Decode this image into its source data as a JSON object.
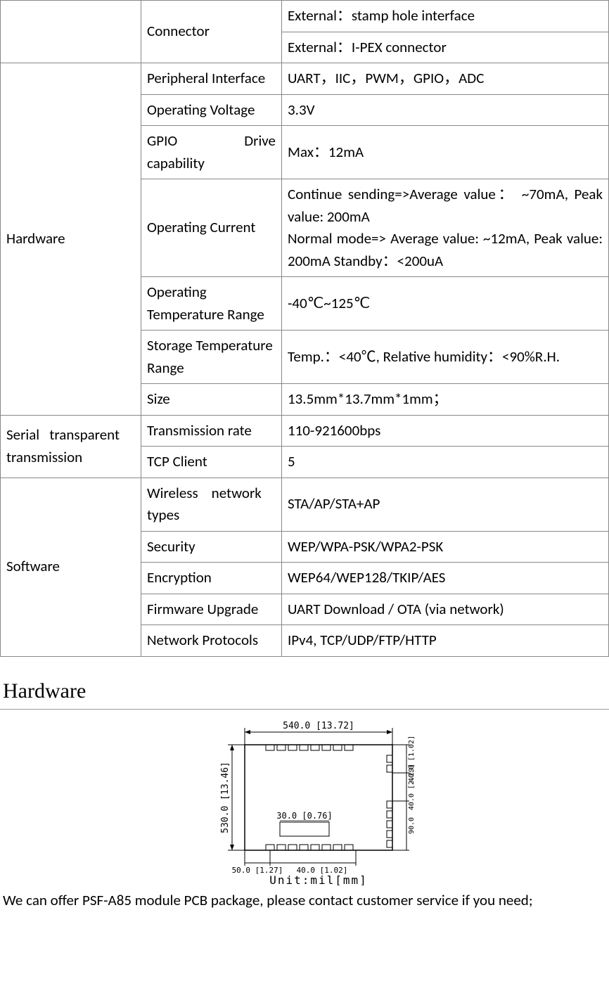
{
  "table": {
    "connector": {
      "label": "Connector",
      "val1": "External：stamp hole interface",
      "val2": "External：I-PEX connector"
    },
    "hardware": {
      "label": "Hardware",
      "rows": [
        {
          "k": "Peripheral Interface",
          "v": "UART，IIC，PWM，GPIO，ADC"
        },
        {
          "k": "Operating Voltage",
          "v": "3.3V"
        },
        {
          "k": "GPIO Drive capability",
          "v": "Max：12mA"
        },
        {
          "k": "Operating Current",
          "v": "Continue sending=>Average value： ~70mA, Peak value: 200mA\nNormal mode=> Average value: ~12mA, Peak value: 200mA Standby：<200uA"
        },
        {
          "k": "Operating Temperature Range",
          "v": "-40℃~125℃"
        },
        {
          "k": "Storage Temperature Range",
          "v": "Temp.：<40℃, Relative humidity：<90%R.H."
        },
        {
          "k": "Size",
          "v": "13.5mm*13.7mm*1mm；"
        }
      ]
    },
    "serial": {
      "label": "Serial transparent transmission",
      "rows": [
        {
          "k": "Transmission rate",
          "v": "110-921600bps"
        },
        {
          "k": "TCP Client",
          "v": "5"
        }
      ]
    },
    "software": {
      "label": "Software",
      "rows": [
        {
          "k": "Wireless network types",
          "v": "STA/AP/STA+AP"
        },
        {
          "k": "Security",
          "v": "WEP/WPA-PSK/WPA2-PSK"
        },
        {
          "k": "Encryption",
          "v": "WEP64/WEP128/TKIP/AES"
        },
        {
          "k": "Firmware Upgrade",
          "v": "UART Download / OTA (via network)"
        },
        {
          "k": "Network Protocols",
          "v": "IPv4, TCP/UDP/FTP/HTTP"
        }
      ]
    }
  },
  "heading": "Hardware",
  "diagram": {
    "dim_top": "540.0  [13.72]",
    "dim_left": "530.0 [13.46]",
    "dim_inner_w": "30.0  [0.76]",
    "dim_bot_l": "50.0 [1.27]",
    "dim_bot_r": "40.0 [1.02]",
    "dim_right_top": "40.0 [1.02]",
    "dim_right_mid": "40.0 [2.29]",
    "dim_right_bot": "90.0",
    "unit": "Unit:mil[mm]"
  },
  "footer": "We can offer PSF-A85 module PCB package, please contact customer service if you need;"
}
